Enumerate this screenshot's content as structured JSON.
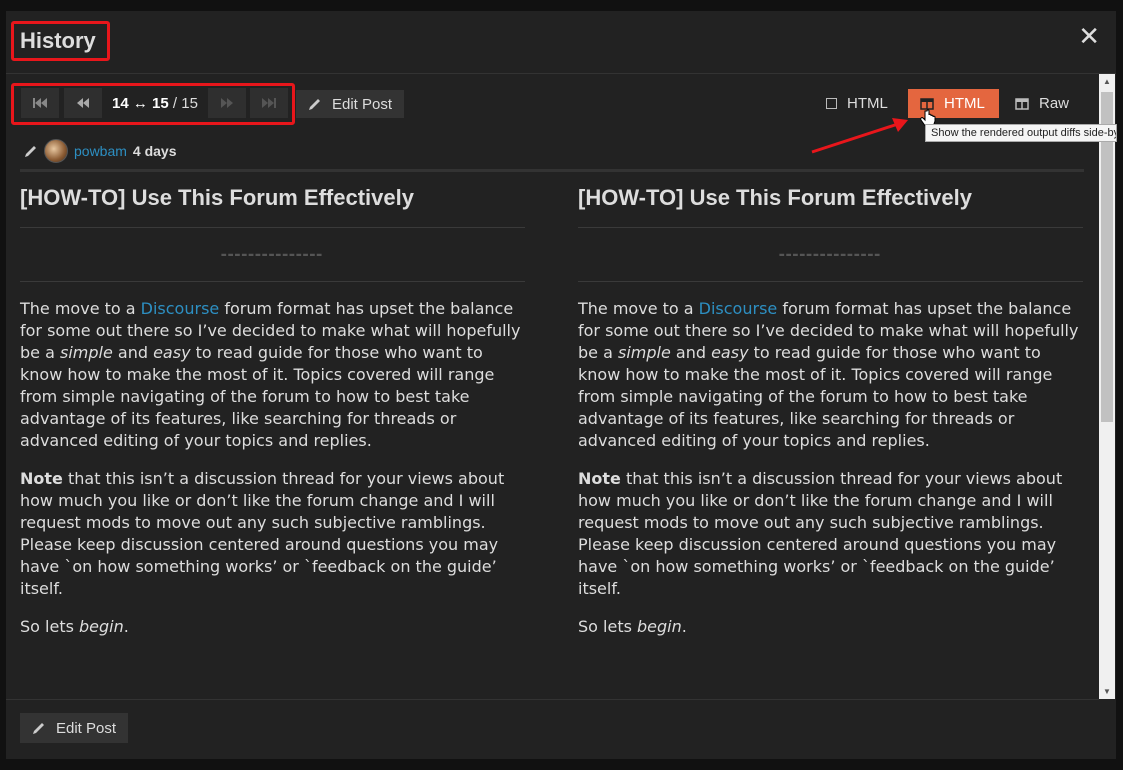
{
  "modal": {
    "title": "History",
    "close": "✕"
  },
  "nav": {
    "first_icon": "first-icon",
    "prev_icon": "prev-icon",
    "next_icon": "next-icon",
    "last_icon": "last-icon",
    "from": "14",
    "arrow": "↔",
    "to": "15",
    "total": "/ 15",
    "edit_label": "Edit Post"
  },
  "view": {
    "options": [
      {
        "label": "HTML",
        "active": false
      },
      {
        "label": "HTML",
        "active": true
      },
      {
        "label": "Raw",
        "active": false
      }
    ],
    "tooltip": "Show the rendered output diffs side-by-side"
  },
  "revision": {
    "user": "powbam",
    "age": "4 days"
  },
  "content": {
    "title": "[HOW-TO] Use This Forum Effectively",
    "p1_a": "The move to a ",
    "p1_link": "Discourse",
    "p1_b": " forum format has upset the balance for some out there so I’ve decided to make what will hopefully be a ",
    "p1_em1": "simple",
    "p1_c": " and ",
    "p1_em2": "easy",
    "p1_d": " to read guide for those who want to know how to make the most of it. Topics covered will range from simple navigating of the forum to how to best take advantage of its features, like searching for threads or advanced editing of your topics and replies.",
    "p2_strong": "Note",
    "p2_rest": " that this isn’t a discussion thread for your views about how much you like or don’t like the forum change and I will request mods to move out any such subjective ramblings. Please keep discussion centered around questions you may have `on how something works’ or `feedback on the guide’ itself.",
    "p3_a": "So lets ",
    "p3_em": "begin",
    "p3_b": "."
  },
  "footer": {
    "edit_label": "Edit Post"
  },
  "colors": {
    "accent": "#e4663f",
    "link": "#2d8fc2",
    "highlight": "#e8161b"
  }
}
